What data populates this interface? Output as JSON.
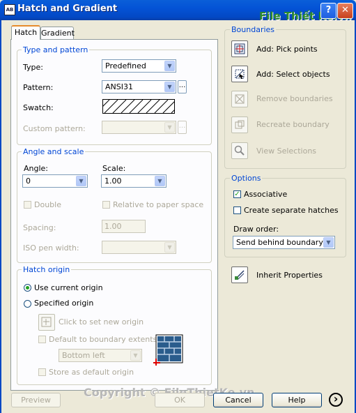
{
  "window": {
    "title": "Hatch and Gradient",
    "app_icon_text": "AB",
    "help_glyph": "?",
    "close_glyph": "✕"
  },
  "watermark": {
    "top": "File Thiết Kế.vn",
    "bottom": "Copyright © FileThietKe.vn"
  },
  "tabs": [
    {
      "label": "Hatch"
    },
    {
      "label": "Gradient"
    }
  ],
  "type_pattern": {
    "title": "Type and pattern",
    "type_label": "Type:",
    "type_value": "Predefined",
    "pattern_label": "Pattern:",
    "pattern_value": "ANSI31",
    "pattern_browse": "...",
    "swatch_label": "Swatch:",
    "custom_pattern_label": "Custom pattern:",
    "custom_pattern_value": "",
    "custom_browse": "..."
  },
  "angle_scale": {
    "title": "Angle and scale",
    "angle_label": "Angle:",
    "angle_value": "0",
    "scale_label": "Scale:",
    "scale_value": "1.00",
    "double_label": "Double",
    "relative_label": "Relative to paper space",
    "spacing_label": "Spacing:",
    "spacing_value": "1.00",
    "iso_label": "ISO pen width:",
    "iso_value": ""
  },
  "hatch_origin": {
    "title": "Hatch origin",
    "use_current": "Use current origin",
    "specified": "Specified origin",
    "click_to_set": "Click to set new origin",
    "default_extents": "Default to boundary extents",
    "position_value": "Bottom left",
    "store_default": "Store as default origin"
  },
  "boundaries": {
    "title": "Boundaries",
    "items": [
      {
        "label": "Add: Pick points",
        "icon": "pick-points-icon",
        "enabled": true
      },
      {
        "label": "Add: Select objects",
        "icon": "select-objects-icon",
        "enabled": true
      },
      {
        "label": "Remove boundaries",
        "icon": "remove-boundaries-icon",
        "enabled": false
      },
      {
        "label": "Recreate boundary",
        "icon": "recreate-boundary-icon",
        "enabled": false
      },
      {
        "label": "View Selections",
        "icon": "magnifier-icon",
        "enabled": false
      }
    ]
  },
  "options": {
    "title": "Options",
    "associative": "Associative",
    "associative_checked": true,
    "separate": "Create separate hatches",
    "separate_checked": false,
    "draw_order_label": "Draw order:",
    "draw_order_value": "Send behind boundary"
  },
  "inherit": {
    "label": "Inherit Properties",
    "icon": "inherit-properties-icon"
  },
  "footer": {
    "preview": "Preview",
    "ok": "OK",
    "cancel": "Cancel",
    "help": "Help",
    "more_glyph": "›"
  }
}
